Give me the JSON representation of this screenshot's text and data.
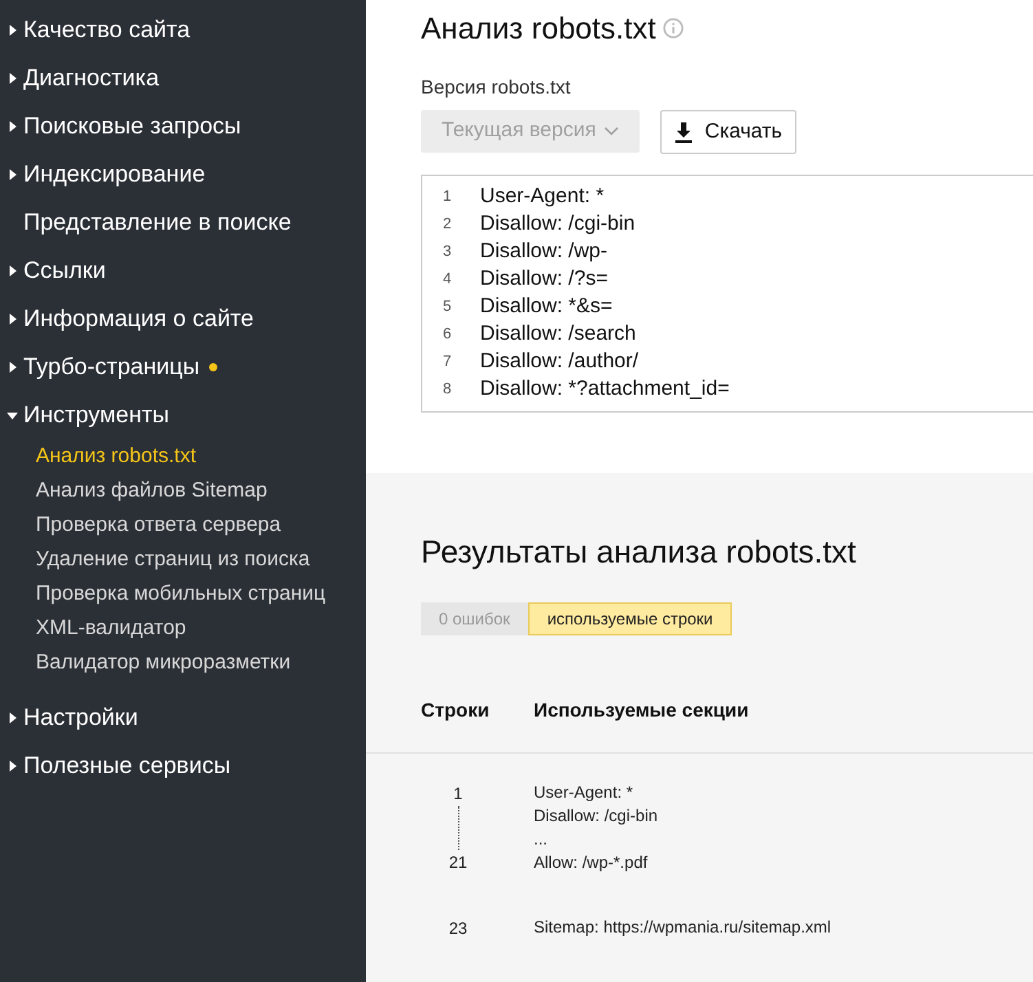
{
  "sidebar": {
    "items": [
      {
        "label": "Качество сайта",
        "kind": "group",
        "expanded": false,
        "dot": false
      },
      {
        "label": "Диагностика",
        "kind": "group",
        "expanded": false,
        "dot": false
      },
      {
        "label": "Поисковые запросы",
        "kind": "group",
        "expanded": false,
        "dot": false
      },
      {
        "label": "Индексирование",
        "kind": "group",
        "expanded": false,
        "dot": false
      },
      {
        "label": "Представление в поиске",
        "kind": "link",
        "dot": false
      },
      {
        "label": "Ссылки",
        "kind": "group",
        "expanded": false,
        "dot": false
      },
      {
        "label": "Информация о сайте",
        "kind": "group",
        "expanded": false,
        "dot": false
      },
      {
        "label": "Турбо-страницы",
        "kind": "group",
        "expanded": false,
        "dot": true
      },
      {
        "label": "Инструменты",
        "kind": "group",
        "expanded": true,
        "dot": false,
        "children": [
          {
            "label": "Анализ robots.txt",
            "selected": true
          },
          {
            "label": "Анализ файлов Sitemap",
            "selected": false
          },
          {
            "label": "Проверка ответа сервера",
            "selected": false
          },
          {
            "label": "Удаление страниц из поиска",
            "selected": false
          },
          {
            "label": "Проверка мобильных страниц",
            "selected": false
          },
          {
            "label": "XML-валидатор",
            "selected": false
          },
          {
            "label": "Валидатор микроразметки",
            "selected": false
          }
        ]
      },
      {
        "label": "Настройки",
        "kind": "group",
        "expanded": false,
        "dot": false
      },
      {
        "label": "Полезные сервисы",
        "kind": "group",
        "expanded": false,
        "dot": false
      }
    ]
  },
  "page_title": "Анализ robots.txt",
  "version": {
    "label": "Версия robots.txt",
    "select": "Текущая версия",
    "select_disabled": true,
    "download": "Скачать"
  },
  "editor": {
    "lines": [
      {
        "number": "1",
        "text": "User-Agent: *"
      },
      {
        "number": "2",
        "text": "Disallow: /cgi-bin"
      },
      {
        "number": "3",
        "text": "Disallow: /wp-"
      },
      {
        "number": "4",
        "text": "Disallow: /?s="
      },
      {
        "number": "5",
        "text": "Disallow: *&s="
      },
      {
        "number": "6",
        "text": "Disallow: /search"
      },
      {
        "number": "7",
        "text": "Disallow: /author/"
      },
      {
        "number": "8",
        "text": "Disallow: *?attachment_id="
      }
    ]
  },
  "results": {
    "title": "Результаты анализа robots.txt",
    "tabs": [
      {
        "label": "0 ошибок",
        "selected": false
      },
      {
        "label": "используемые строки",
        "selected": true
      }
    ],
    "columns": [
      "Строки",
      "Используемые секции"
    ],
    "rows": [
      {
        "line_start": "1",
        "line_end": "21",
        "lines": [
          "User-Agent: *",
          "Disallow: /cgi-bin",
          "...",
          "Allow: /wp-*.pdf"
        ]
      },
      {
        "line_start": "23",
        "lines": [
          "Sitemap: https://wpmania.ru/sitemap.xml"
        ]
      }
    ]
  }
}
